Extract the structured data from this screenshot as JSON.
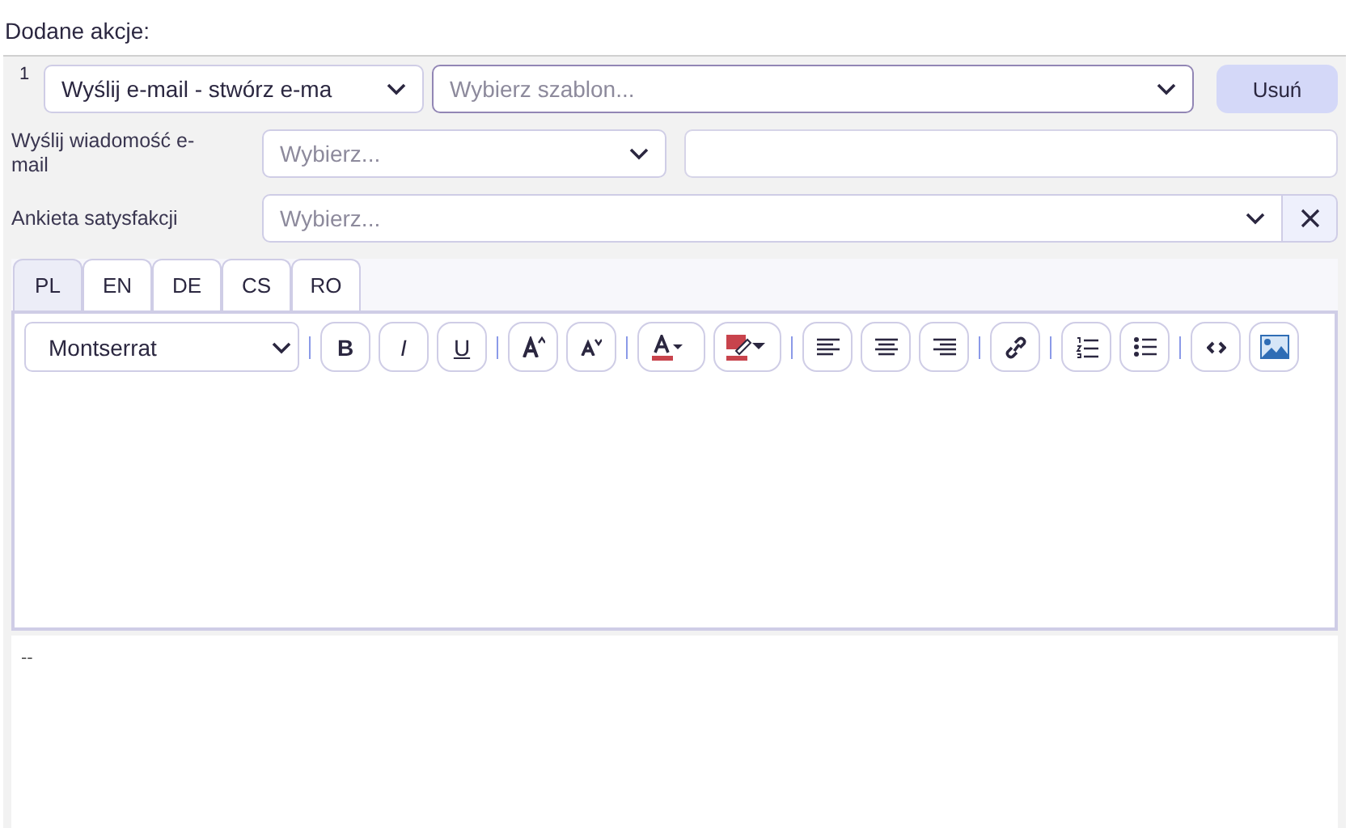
{
  "heading": "Dodane akcje:",
  "action": {
    "number": "1",
    "type_value": "Wyślij e-mail - stwórz e-ma",
    "template_placeholder": "Wybierz szablon...",
    "delete_label": "Usuń"
  },
  "fields": [
    {
      "label": "Wyślij wiadomość e-mail",
      "placeholder": "Wybierz...",
      "kind": "select-with-input"
    },
    {
      "label": "Ankieta satysfakcji",
      "placeholder": "Wybierz...",
      "kind": "select-clearable"
    }
  ],
  "tabs": [
    {
      "label": "PL",
      "selected": true
    },
    {
      "label": "EN",
      "selected": false
    },
    {
      "label": "DE",
      "selected": false
    },
    {
      "label": "CS",
      "selected": false
    },
    {
      "label": "RO",
      "selected": false
    }
  ],
  "editor": {
    "font": "Montserrat",
    "groups": [
      [
        {
          "kind": "bold",
          "label": "B"
        },
        {
          "kind": "italic",
          "label": "I"
        },
        {
          "kind": "underline",
          "label": "U"
        }
      ],
      [
        {
          "kind": "font-grow"
        },
        {
          "kind": "font-shrink"
        }
      ],
      [
        {
          "kind": "text-color"
        },
        {
          "kind": "highlight"
        }
      ],
      [
        {
          "kind": "align-left"
        },
        {
          "kind": "align-center"
        },
        {
          "kind": "align-right"
        }
      ],
      [
        {
          "kind": "link"
        }
      ],
      [
        {
          "kind": "ordered-list"
        },
        {
          "kind": "bullet-list"
        }
      ],
      [
        {
          "kind": "code"
        },
        {
          "kind": "image"
        }
      ]
    ]
  },
  "signature": "--"
}
